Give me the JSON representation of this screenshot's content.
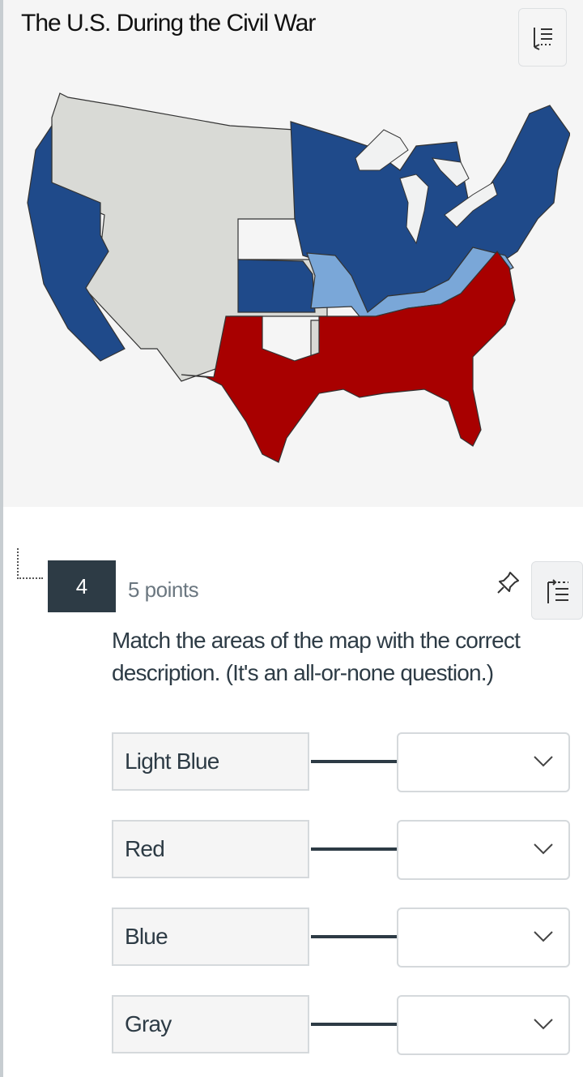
{
  "header": {
    "title": "The U.S. During the Civil War",
    "toggle_icon": "list-indent-icon"
  },
  "map": {
    "description": "Map of the United States during the Civil War, states colored by category",
    "colors": {
      "blue": "#1f4a8a",
      "light_blue": "#7aa7d8",
      "red": "#a80000",
      "gray": "#d9dad6",
      "water": "#f5f5f5"
    }
  },
  "question": {
    "number": "4",
    "points": "5 points",
    "pin_icon": "pin-icon",
    "menu_icon": "list-indent-icon",
    "text": "Match the areas of the map with the correct description. (It's an all-or-none question.)",
    "matches": [
      {
        "prompt": "Light Blue",
        "selected": ""
      },
      {
        "prompt": "Red",
        "selected": ""
      },
      {
        "prompt": "Blue",
        "selected": ""
      },
      {
        "prompt": "Gray",
        "selected": ""
      }
    ]
  },
  "colors": {
    "question_badge_bg": "#2d3b45",
    "text": "#2d3b45",
    "muted": "#6b7780"
  }
}
